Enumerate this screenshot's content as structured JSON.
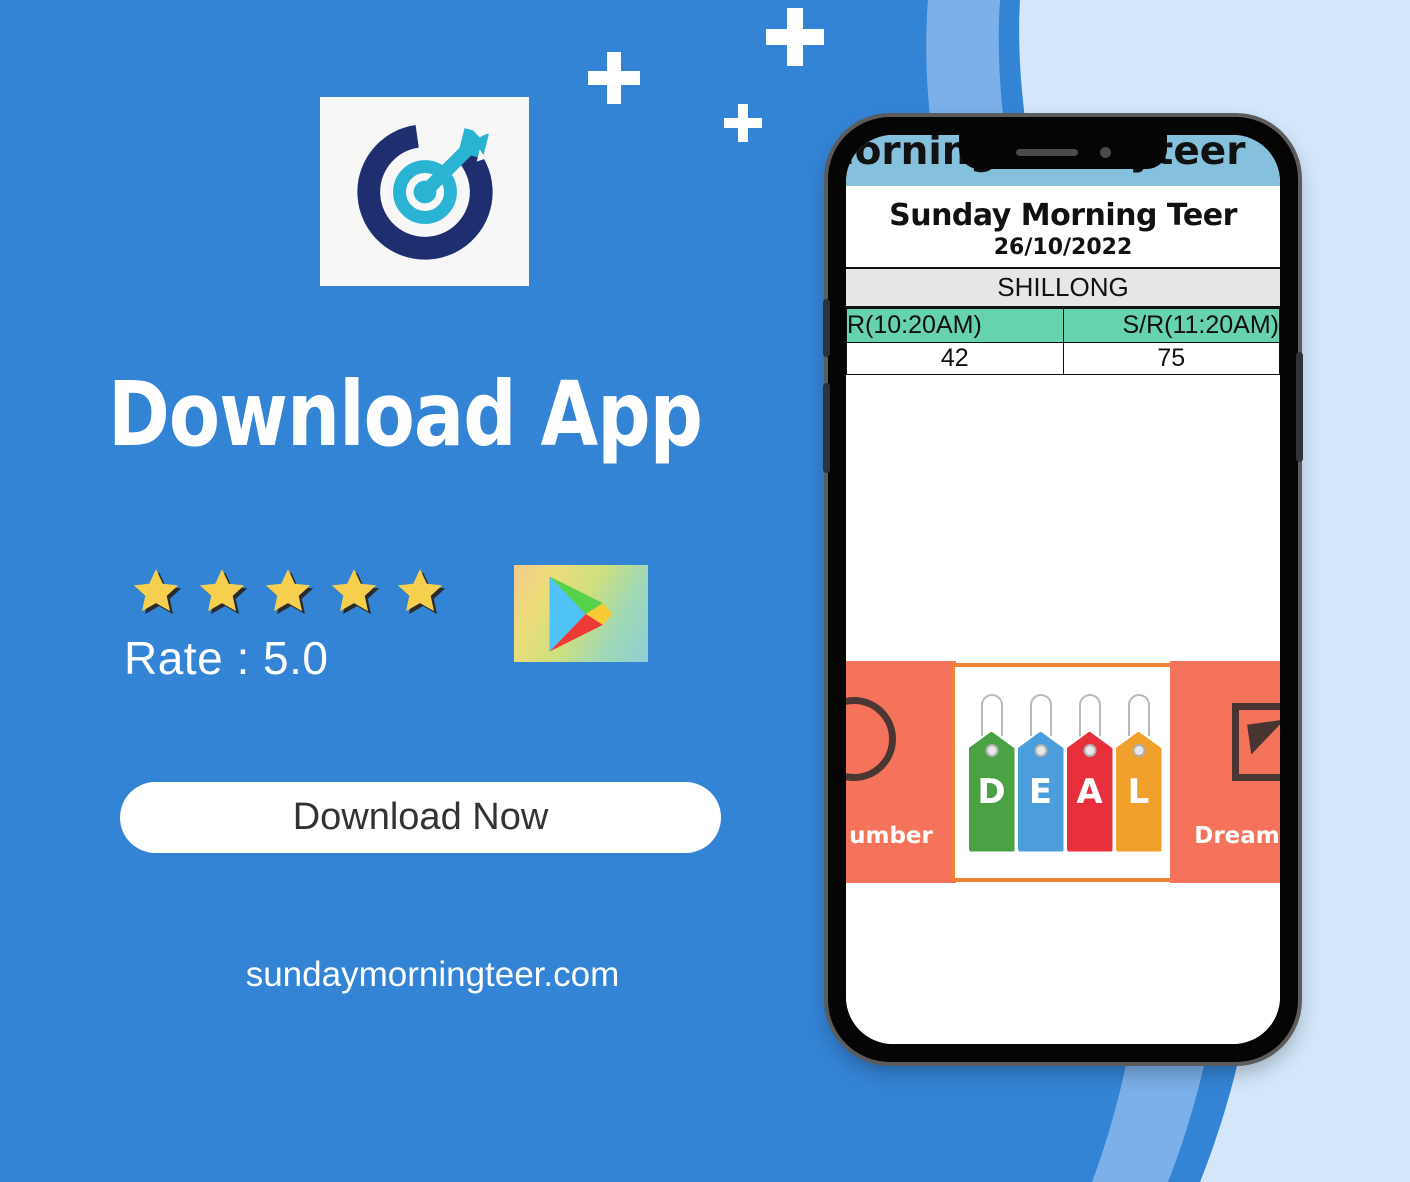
{
  "theme": {
    "background_blue": "#3484d6",
    "wave_mid_blue": "#7bb0ea",
    "wave_light_blue": "#d3e6fa",
    "star_gold": "#f7cf4f",
    "promo_orange": "#f4735a",
    "table_header_teal": "#66d2af",
    "site_header_blue": "#85c1dd"
  },
  "logo": {
    "icon": "target-dart-icon",
    "ring_outer_color": "#1f2e6e",
    "ring_inner_color": "#2bb3d4",
    "background": "#f7f7f7"
  },
  "headline": "Download App",
  "rating": {
    "stars_filled": 5,
    "stars_total": 5,
    "label": "Rate : 5.0",
    "store_badge_icon": "google-play-icon"
  },
  "cta": {
    "label": "Download Now"
  },
  "site_url": "sundaymorningteer.com",
  "decorations": {
    "plus_marks": [
      "plus-large",
      "plus-medium",
      "plus-small"
    ]
  },
  "phone": {
    "notch": {
      "speaker": "speaker-grill",
      "camera": "front-camera-dot"
    },
    "buttons": [
      "mute-switch",
      "volume-button",
      "power-button"
    ],
    "screen": {
      "site_header_text": "morningsundayteer",
      "result": {
        "title": "Sunday Morning Teer",
        "date": "26/10/2022",
        "city": "SHILLONG",
        "columns": [
          "R(10:20AM)",
          "S/R(11:20AM)"
        ],
        "values": [
          "42",
          "75"
        ]
      },
      "promo": {
        "left_label": "umber",
        "right_label": "Dream",
        "left_glyph": "circle-icon",
        "right_glyph": "megaphone-icon",
        "deal_card": {
          "border_color": "#ef8034",
          "tags": [
            {
              "letter": "D",
              "color": "#4aa244"
            },
            {
              "letter": "E",
              "color": "#4b9ddb"
            },
            {
              "letter": "A",
              "color": "#e8303c"
            },
            {
              "letter": "L",
              "color": "#f0a02b"
            }
          ]
        }
      }
    }
  }
}
